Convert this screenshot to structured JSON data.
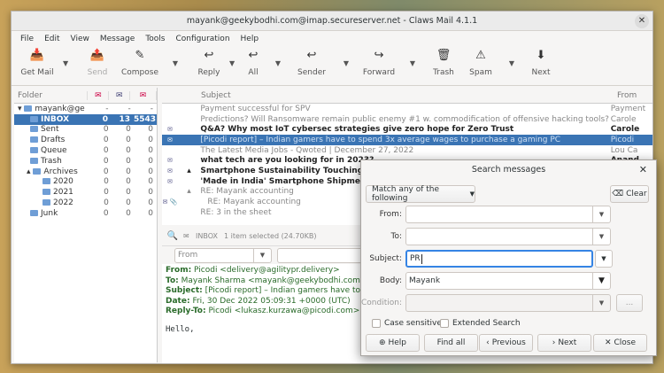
{
  "window": {
    "title": "mayank@geekybodhi.com@imap.secureserver.net - Claws Mail 4.1.1",
    "close": "✕"
  },
  "menu": [
    "File",
    "Edit",
    "View",
    "Message",
    "Tools",
    "Configuration",
    "Help"
  ],
  "toolbar": {
    "get_mail": "Get Mail",
    "send": "Send",
    "compose": "Compose",
    "reply": "Reply",
    "all": "All",
    "sender": "Sender",
    "forward": "Forward",
    "trash": "Trash",
    "spam": "Spam",
    "next": "Next"
  },
  "folders": {
    "header": "Folder",
    "rows": [
      {
        "name": "mayank@ge",
        "unread": "-",
        "new": "-",
        "total": "-"
      },
      {
        "name": "INBOX",
        "unread": "0",
        "new": "13",
        "total": "5543"
      },
      {
        "name": "Sent",
        "unread": "0",
        "new": "0",
        "total": "0"
      },
      {
        "name": "Drafts",
        "unread": "0",
        "new": "0",
        "total": "0"
      },
      {
        "name": "Queue",
        "unread": "0",
        "new": "0",
        "total": "0"
      },
      {
        "name": "Trash",
        "unread": "0",
        "new": "0",
        "total": "0"
      },
      {
        "name": "Archives",
        "unread": "0",
        "new": "0",
        "total": "0"
      },
      {
        "name": "2020",
        "unread": "0",
        "new": "0",
        "total": "0"
      },
      {
        "name": "2021",
        "unread": "0",
        "new": "0",
        "total": "0"
      },
      {
        "name": "2022",
        "unread": "0",
        "new": "0",
        "total": "0"
      },
      {
        "name": "Junk",
        "unread": "0",
        "new": "0",
        "total": "0"
      }
    ]
  },
  "list": {
    "subject_header": "Subject",
    "from_header": "From",
    "rows": [
      {
        "subject": "Payment successful for SPV",
        "from": "Payment"
      },
      {
        "subject": "Predictions? Will Ransomware remain public enemy #1 w. commodification of offensive hacking tools?",
        "from": "Carole"
      },
      {
        "subject": "Q&A? Why most IoT cybersec strategies give zero hope for Zero Trust",
        "from": "Carole"
      },
      {
        "subject": "[Picodi report] – Indian gamers have to spend 3x average wages to purchase a gaming PC",
        "from": "Picodi"
      },
      {
        "subject": "The Latest Media Jobs - Qwoted | December 27, 2022",
        "from": "Lou Ca"
      },
      {
        "subject": "what tech are you looking for in 2023?",
        "from": "Anand"
      },
      {
        "subject": "Smartphone Sustainability Touching",
        "from": ""
      },
      {
        "subject": "'Made in India' Smartphone Shipme",
        "from": ""
      },
      {
        "subject": "RE: Mayank accounting",
        "from": ""
      },
      {
        "subject": "RE: Mayank accounting",
        "from": ""
      },
      {
        "subject": "RE: 3 in the sheet",
        "from": ""
      }
    ]
  },
  "message": {
    "folder": "INBOX",
    "status": "1 item selected (24.70KB)",
    "filter_from": "From",
    "from_label": "From:",
    "from_value": "Picodi <delivery@agilitypr.delivery>",
    "to_label": "To:",
    "to_value": "Mayank Sharma <mayank@geekybodhi.com>",
    "subject_label": "Subject:",
    "subject_value": "[Picodi report] – Indian gamers have to s",
    "date_label": "Date:",
    "date_value": "Fri, 30 Dec 2022 05:09:31 +0000 (UTC)",
    "replyto_label": "Reply-To:",
    "replyto_value": "Picodi <lukasz.kurzawa@picodi.com>",
    "body": "Hello,"
  },
  "search": {
    "title": "Search messages",
    "match": "Match any of the following",
    "clear": "Clear",
    "from_label": "From:",
    "from_value": "",
    "to_label": "To:",
    "to_value": "",
    "subject_label": "Subject:",
    "subject_value": "PR",
    "body_label": "Body:",
    "body_value": "Mayank",
    "condition_label": "Condition:",
    "condition_value": "",
    "condition_btn": "...",
    "case_sensitive": "Case sensitive",
    "extended_search": "Extended Search",
    "help": "Help",
    "find_all": "Find all",
    "previous": "Previous",
    "next": "Next",
    "close": "Close"
  }
}
